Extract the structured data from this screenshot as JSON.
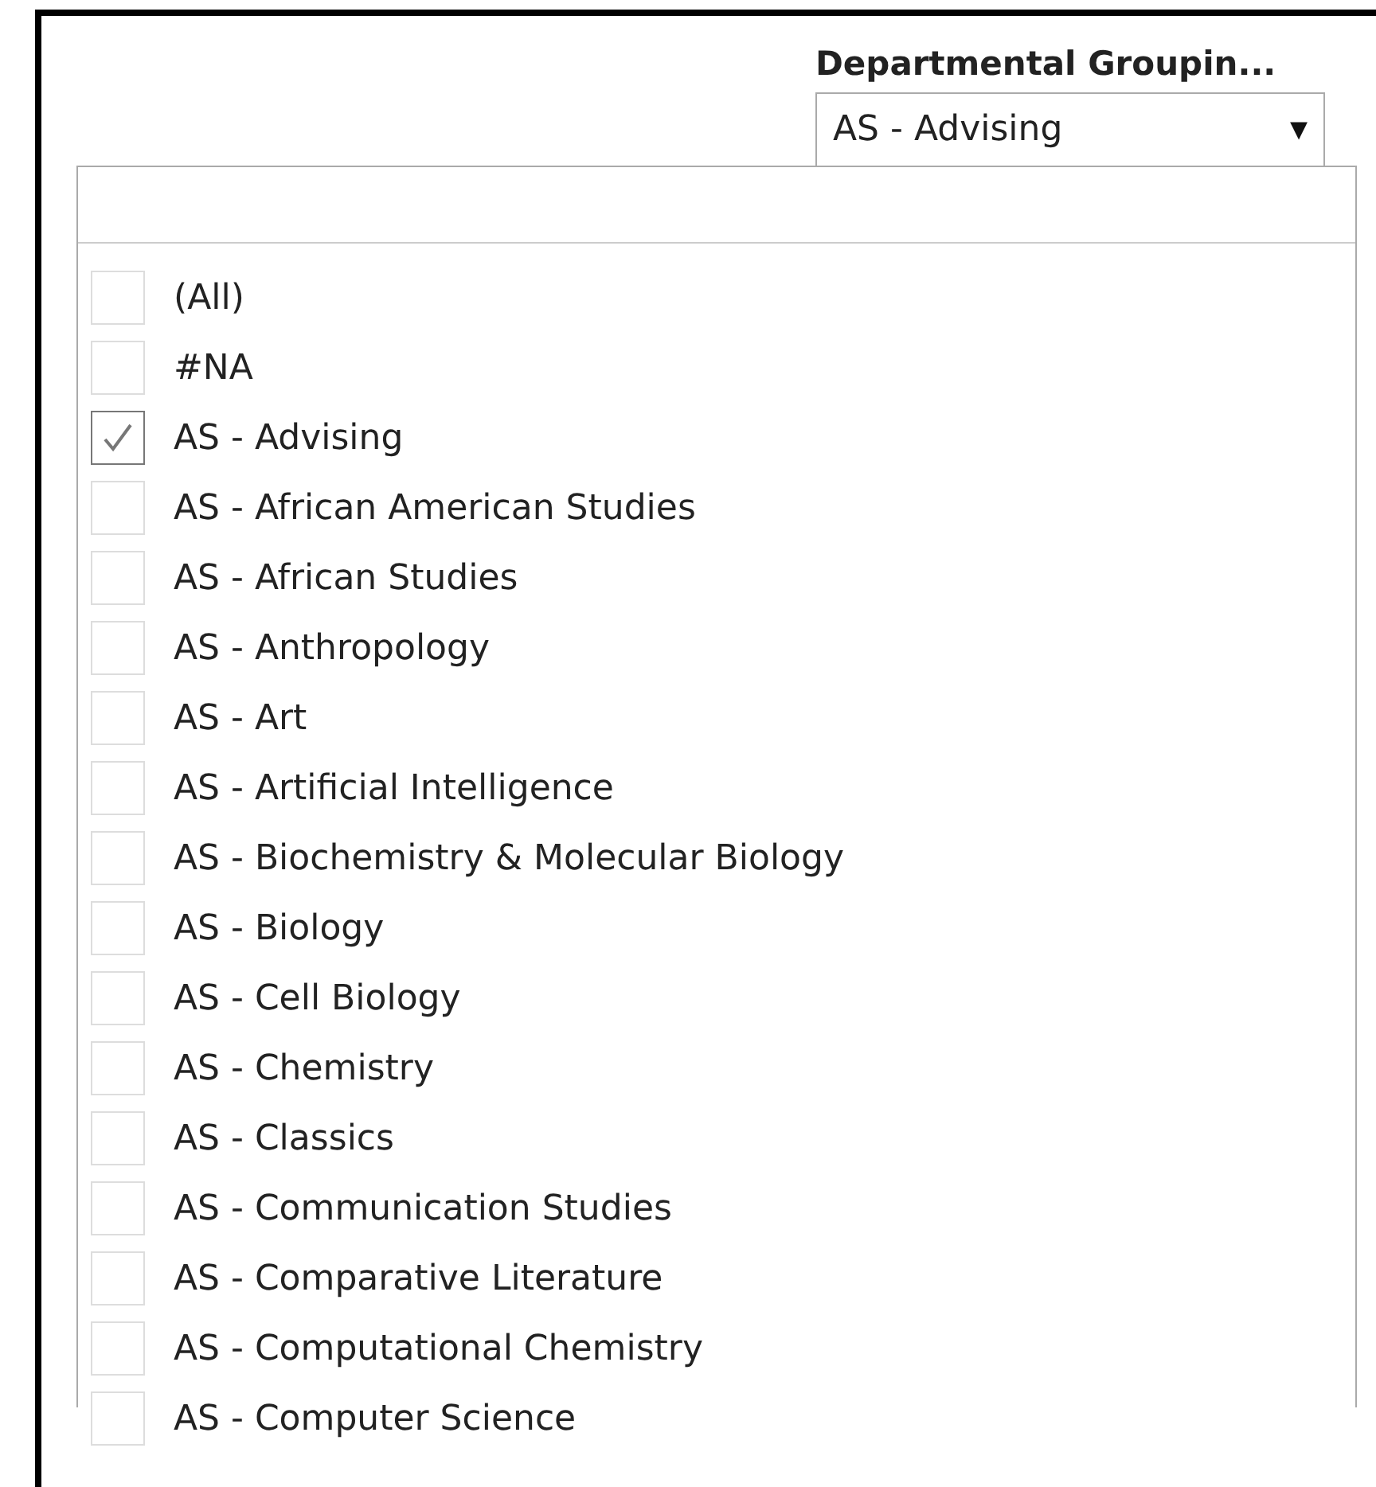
{
  "filter": {
    "title": "Departmental Groupin...",
    "value": "AS - Advising",
    "caret": "▾"
  },
  "items": [
    {
      "label": "(All)",
      "checked": false
    },
    {
      "label": "#NA",
      "checked": false
    },
    {
      "label": "AS - Advising",
      "checked": true
    },
    {
      "label": "AS - African American Studies",
      "checked": false
    },
    {
      "label": "AS - African Studies",
      "checked": false
    },
    {
      "label": "AS - Anthropology",
      "checked": false
    },
    {
      "label": "AS - Art",
      "checked": false
    },
    {
      "label": "AS - Artificial Intelligence",
      "checked": false
    },
    {
      "label": "AS - Biochemistry & Molecular Biology",
      "checked": false
    },
    {
      "label": "AS - Biology",
      "checked": false
    },
    {
      "label": "AS - Cell Biology",
      "checked": false
    },
    {
      "label": "AS - Chemistry",
      "checked": false
    },
    {
      "label": "AS - Classics",
      "checked": false
    },
    {
      "label": "AS - Communication Studies",
      "checked": false
    },
    {
      "label": "AS - Comparative Literature",
      "checked": false
    },
    {
      "label": "AS - Computational Chemistry",
      "checked": false
    },
    {
      "label": "AS - Computer Science",
      "checked": false
    }
  ]
}
